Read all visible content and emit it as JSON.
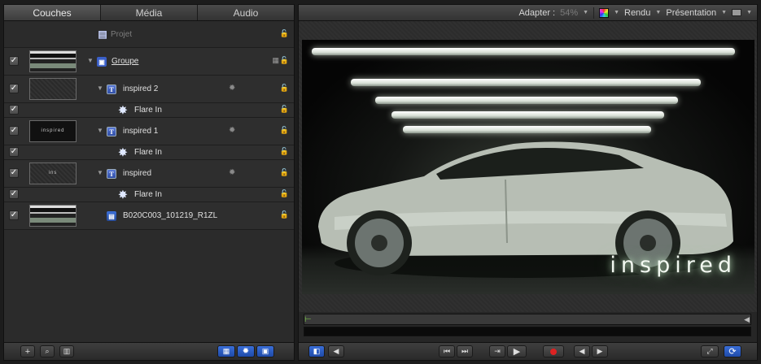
{
  "tabs": [
    "Couches",
    "Média",
    "Audio"
  ],
  "active_tab": "Couches",
  "project_label": "Projet",
  "layers": [
    {
      "name": "Groupe",
      "kind": "group",
      "checked": true,
      "thumb": "image"
    },
    {
      "name": "inspired 2",
      "kind": "text",
      "checked": true,
      "thumb": "dark"
    },
    {
      "name": "Flare In",
      "kind": "behavior",
      "checked": true
    },
    {
      "name": "inspired 1",
      "kind": "text",
      "checked": true,
      "thumb": "text",
      "thumb_text": "inspired"
    },
    {
      "name": "Flare In",
      "kind": "behavior",
      "checked": true
    },
    {
      "name": "inspired",
      "kind": "text",
      "checked": true,
      "thumb": "text",
      "thumb_text": "ins"
    },
    {
      "name": "Flare In",
      "kind": "behavior",
      "checked": true
    },
    {
      "name": "B020C003_101219_R1ZL",
      "kind": "clip",
      "checked": true,
      "thumb": "image"
    }
  ],
  "toolbar": {
    "fit_label": "Adapter :",
    "zoom": "54%",
    "render_label": "Rendu",
    "presentation_label": "Présentation"
  },
  "canvas": {
    "overlay_text": "inspired"
  },
  "icons": {
    "add": "+",
    "search": "🔍",
    "check": "✓",
    "lock": "🔒",
    "gear": "✹",
    "flare": "✸",
    "doc": "▤",
    "play": "▶"
  },
  "colors": {
    "accent_blue": "#2f5fc8",
    "record_red": "#d22222",
    "timeline_in": "#7fd04a"
  }
}
